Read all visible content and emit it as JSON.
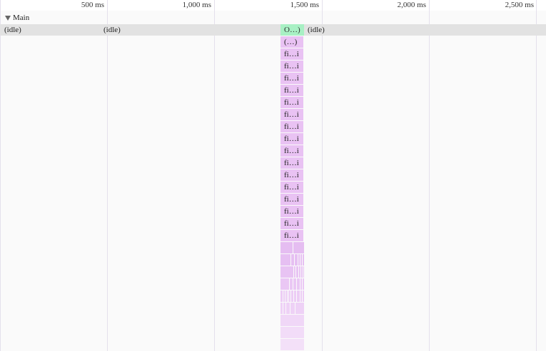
{
  "ruler": {
    "ticks": [
      "500 ms",
      "1,000 ms",
      "1,500 ms",
      "2,000 ms",
      "2,500 ms"
    ]
  },
  "track": {
    "name": "Main"
  },
  "flame": {
    "idle_label": "(idle)",
    "task_label": "O…)",
    "anon_label": "(…)",
    "fn_label": "fi…i",
    "colors": {
      "idle_row": "#e2e2e2",
      "task": "#a8f0c4",
      "function": "#e9c2f3",
      "grid": "#e4e0ec"
    }
  }
}
